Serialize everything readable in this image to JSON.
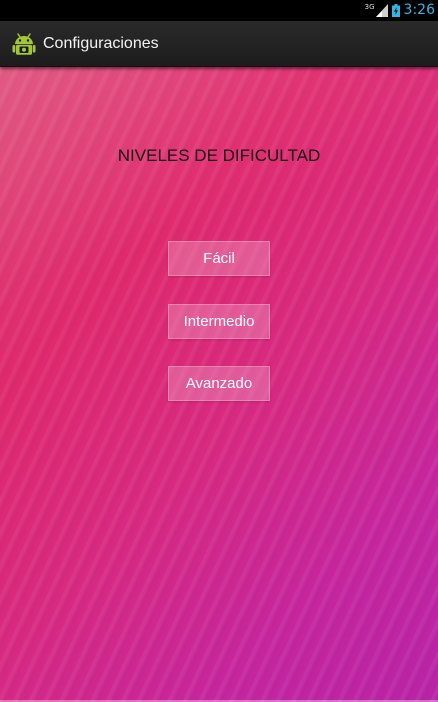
{
  "status_bar": {
    "network_type": "3G",
    "time": "3:26",
    "icons": [
      "signal-icon",
      "battery-icon"
    ]
  },
  "action_bar": {
    "title": "Configuraciones",
    "app_icon": "android-icon"
  },
  "main": {
    "heading": "NIVELES DE DIFICULTAD",
    "buttons": [
      {
        "label": "Fácil"
      },
      {
        "label": "Intermedio"
      },
      {
        "label": "Avanzado"
      }
    ]
  },
  "colors": {
    "clock": "#33b5e5",
    "action_bar": "#222222",
    "background_start": "#e04a78",
    "background_end": "#b924a8"
  }
}
